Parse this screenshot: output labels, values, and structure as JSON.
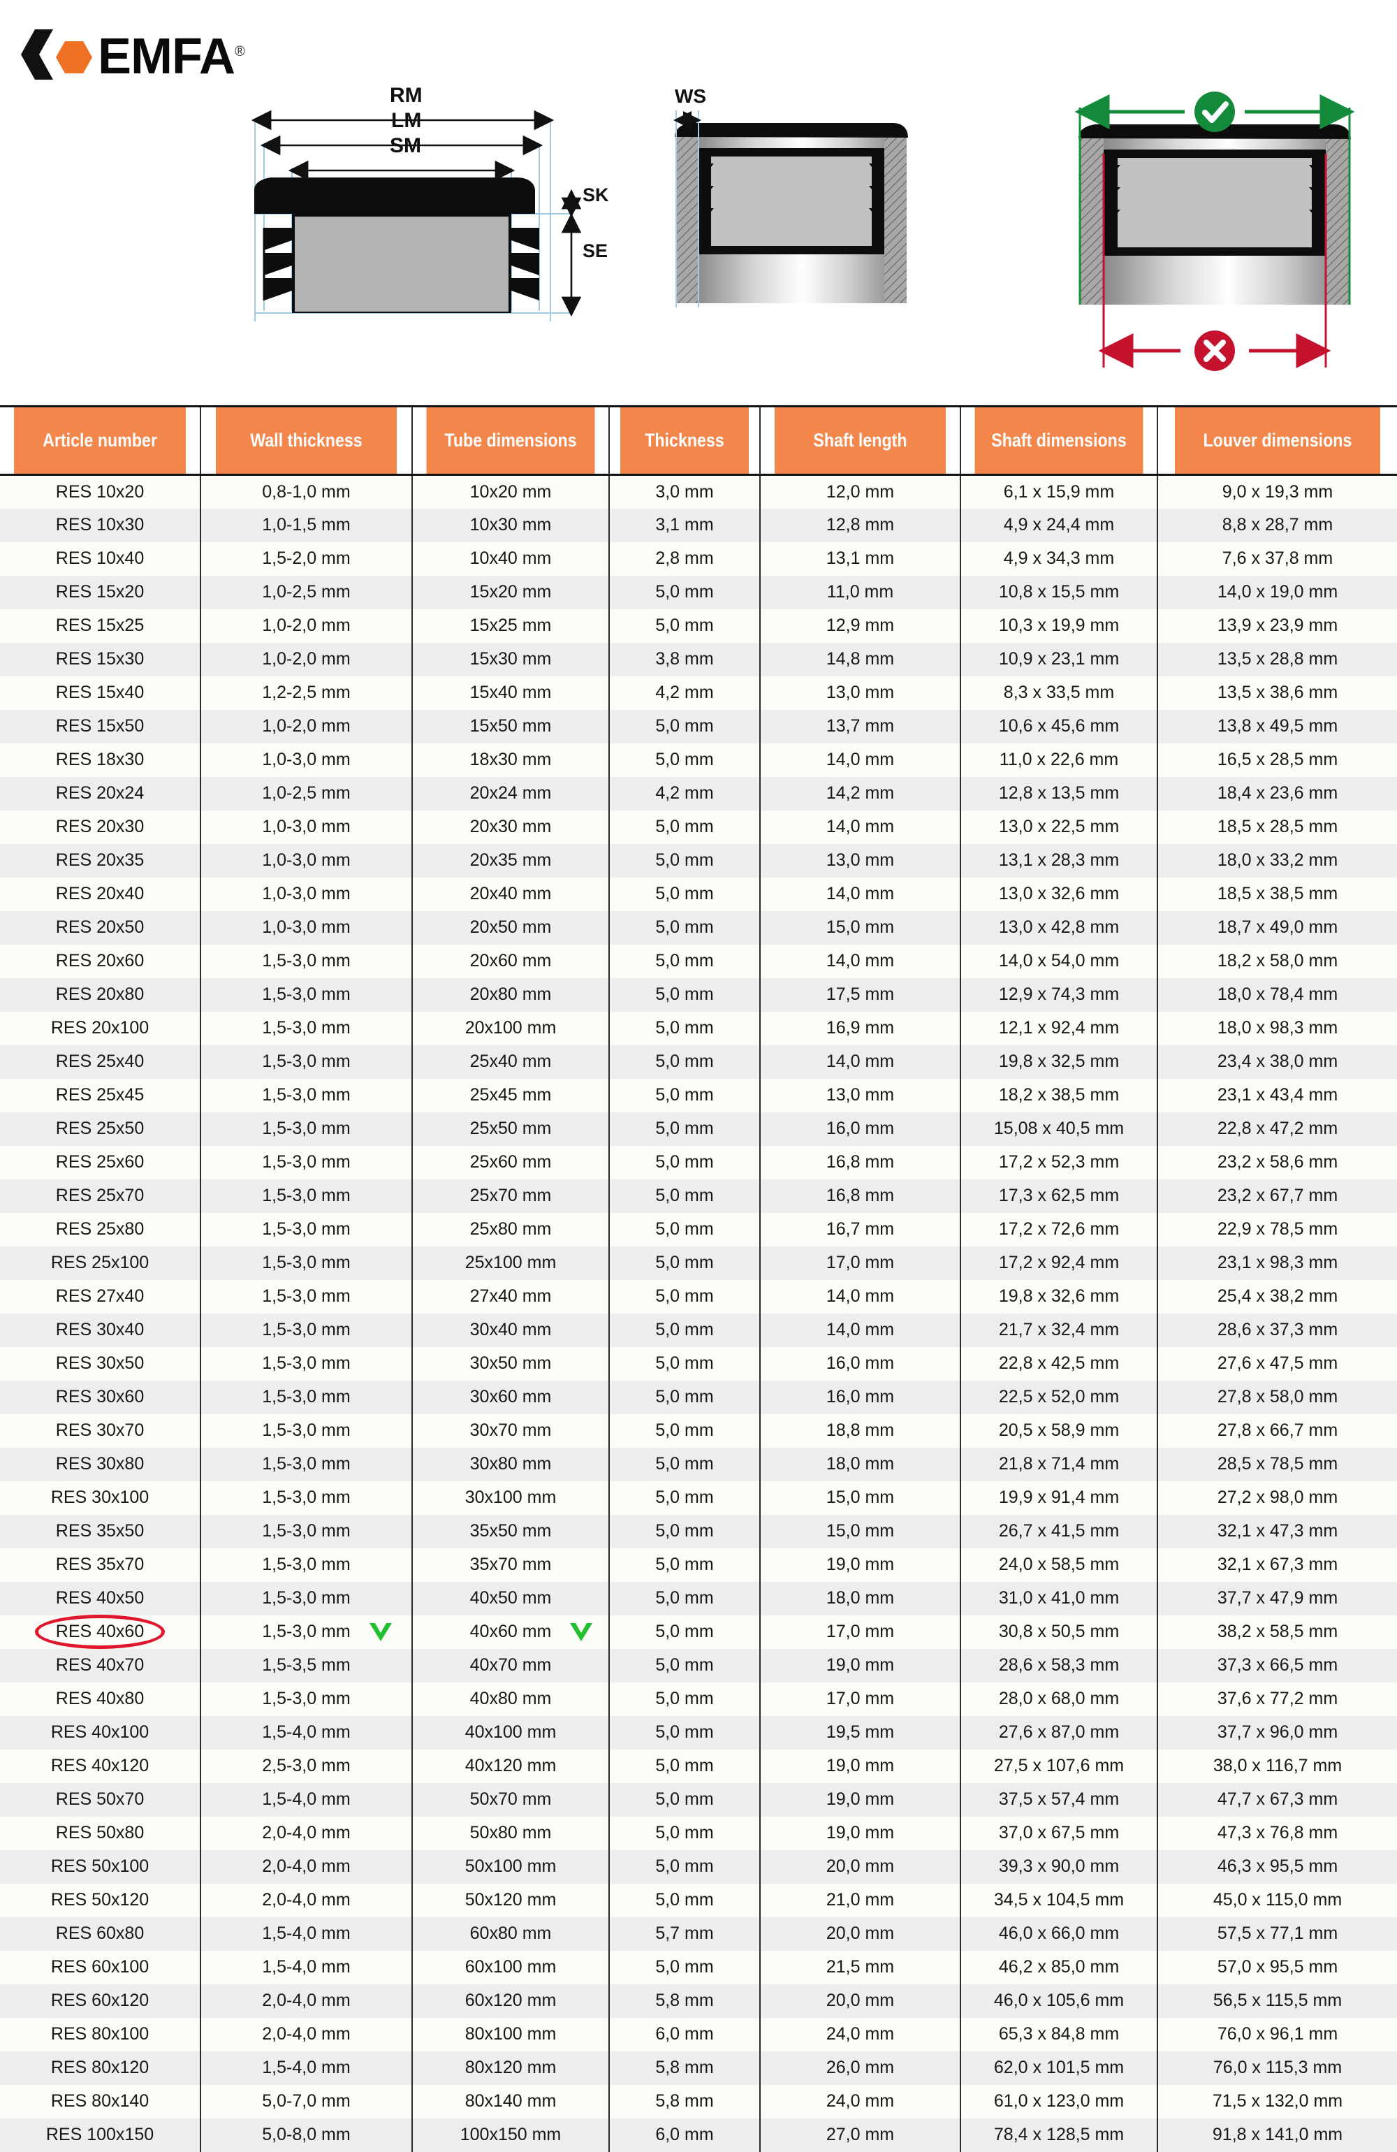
{
  "brand": {
    "name": "EMFA",
    "registered_mark": "®",
    "logo_hex_color": "#EE7023",
    "logo_bracket_color": "#111111"
  },
  "diagrams": {
    "cap_profile": {
      "labels": [
        "RM",
        "LM",
        "SM",
        "SK",
        "SE"
      ],
      "caption_rm": "RM",
      "caption_lm": "LM",
      "caption_sm": "SM",
      "caption_sk": "SK",
      "caption_se": "SE"
    },
    "wall_detail": {
      "caption_ws": "WS"
    },
    "fit_check": {
      "correct_symbol": "check-mark",
      "incorrect_symbol": "cross-mark",
      "correct_color": "#138B3B",
      "incorrect_color": "#C4122F"
    }
  },
  "table": {
    "accent_color": "#F2864B",
    "headers": [
      "Article number",
      "Wall thickness",
      "Tube dimensions",
      "Thickness",
      "Shaft length",
      "Shaft dimensions",
      "Louver dimensions"
    ],
    "highlight": {
      "article": "RES 40x60",
      "ellipse_color": "#E0162B",
      "check_color": "#22C031"
    },
    "rows": [
      [
        "RES 10x20",
        "0,8-1,0 mm",
        "10x20 mm",
        "3,0 mm",
        "12,0 mm",
        "6,1 x 15,9 mm",
        "9,0 x 19,3 mm"
      ],
      [
        "RES 10x30",
        "1,0-1,5 mm",
        "10x30 mm",
        "3,1 mm",
        "12,8 mm",
        "4,9 x 24,4 mm",
        "8,8 x 28,7 mm"
      ],
      [
        "RES 10x40",
        "1,5-2,0 mm",
        "10x40 mm",
        "2,8 mm",
        "13,1 mm",
        "4,9 x 34,3 mm",
        "7,6 x 37,8 mm"
      ],
      [
        "RES 15x20",
        "1,0-2,5 mm",
        "15x20 mm",
        "5,0 mm",
        "11,0 mm",
        "10,8 x 15,5 mm",
        "14,0 x 19,0 mm"
      ],
      [
        "RES 15x25",
        "1,0-2,0 mm",
        "15x25 mm",
        "5,0 mm",
        "12,9 mm",
        "10,3 x 19,9 mm",
        "13,9 x 23,9 mm"
      ],
      [
        "RES 15x30",
        "1,0-2,0 mm",
        "15x30 mm",
        "3,8 mm",
        "14,8 mm",
        "10,9 x 23,1 mm",
        "13,5 x 28,8 mm"
      ],
      [
        "RES 15x40",
        "1,2-2,5 mm",
        "15x40 mm",
        "4,2 mm",
        "13,0 mm",
        "8,3 x 33,5 mm",
        "13,5 x 38,6 mm"
      ],
      [
        "RES 15x50",
        "1,0-2,0 mm",
        "15x50 mm",
        "5,0 mm",
        "13,7 mm",
        "10,6 x 45,6 mm",
        "13,8 x 49,5 mm"
      ],
      [
        "RES 18x30",
        "1,0-3,0 mm",
        "18x30 mm",
        "5,0 mm",
        "14,0 mm",
        "11,0 x 22,6 mm",
        "16,5 x 28,5 mm"
      ],
      [
        "RES 20x24",
        "1,0-2,5 mm",
        "20x24 mm",
        "4,2 mm",
        "14,2 mm",
        "12,8 x 13,5 mm",
        "18,4 x 23,6 mm"
      ],
      [
        "RES 20x30",
        "1,0-3,0 mm",
        "20x30 mm",
        "5,0 mm",
        "14,0 mm",
        "13,0 x 22,5 mm",
        "18,5 x 28,5 mm"
      ],
      [
        "RES 20x35",
        "1,0-3,0 mm",
        "20x35 mm",
        "5,0 mm",
        "13,0 mm",
        "13,1 x 28,3 mm",
        "18,0 x 33,2 mm"
      ],
      [
        "RES 20x40",
        "1,0-3,0 mm",
        "20x40 mm",
        "5,0 mm",
        "14,0 mm",
        "13,0 x 32,6 mm",
        "18,5 x 38,5 mm"
      ],
      [
        "RES 20x50",
        "1,0-3,0 mm",
        "20x50 mm",
        "5,0 mm",
        "15,0 mm",
        "13,0 x 42,8 mm",
        "18,7 x 49,0 mm"
      ],
      [
        "RES 20x60",
        "1,5-3,0 mm",
        "20x60 mm",
        "5,0 mm",
        "14,0 mm",
        "14,0 x 54,0 mm",
        "18,2 x 58,0 mm"
      ],
      [
        "RES 20x80",
        "1,5-3,0 mm",
        "20x80 mm",
        "5,0 mm",
        "17,5 mm",
        "12,9 x 74,3 mm",
        "18,0 x 78,4 mm"
      ],
      [
        "RES 20x100",
        "1,5-3,0 mm",
        "20x100 mm",
        "5,0 mm",
        "16,9 mm",
        "12,1 x 92,4 mm",
        "18,0 x 98,3 mm"
      ],
      [
        "RES 25x40",
        "1,5-3,0 mm",
        "25x40 mm",
        "5,0 mm",
        "14,0 mm",
        "19,8 x 32,5 mm",
        "23,4 x 38,0 mm"
      ],
      [
        "RES 25x45",
        "1,5-3,0 mm",
        "25x45 mm",
        "5,0 mm",
        "13,0 mm",
        "18,2 x 38,5 mm",
        "23,1 x 43,4 mm"
      ],
      [
        "RES 25x50",
        "1,5-3,0 mm",
        "25x50 mm",
        "5,0 mm",
        "16,0 mm",
        "15,08 x 40,5 mm",
        "22,8 x 47,2 mm"
      ],
      [
        "RES 25x60",
        "1,5-3,0 mm",
        "25x60 mm",
        "5,0 mm",
        "16,8 mm",
        "17,2 x 52,3 mm",
        "23,2 x 58,6 mm"
      ],
      [
        "RES 25x70",
        "1,5-3,0 mm",
        "25x70 mm",
        "5,0 mm",
        "16,8 mm",
        "17,3 x 62,5 mm",
        "23,2 x 67,7 mm"
      ],
      [
        "RES 25x80",
        "1,5-3,0 mm",
        "25x80 mm",
        "5,0 mm",
        "16,7 mm",
        "17,2 x 72,6 mm",
        "22,9 x 78,5 mm"
      ],
      [
        "RES 25x100",
        "1,5-3,0 mm",
        "25x100 mm",
        "5,0 mm",
        "17,0 mm",
        "17,2 x 92,4 mm",
        "23,1 x 98,3 mm"
      ],
      [
        "RES 27x40",
        "1,5-3,0 mm",
        "27x40 mm",
        "5,0 mm",
        "14,0 mm",
        "19,8 x 32,6 mm",
        "25,4 x 38,2 mm"
      ],
      [
        "RES 30x40",
        "1,5-3,0 mm",
        "30x40 mm",
        "5,0 mm",
        "14,0 mm",
        "21,7 x 32,4 mm",
        "28,6 x 37,3 mm"
      ],
      [
        "RES 30x50",
        "1,5-3,0 mm",
        "30x50 mm",
        "5,0 mm",
        "16,0 mm",
        "22,8 x 42,5 mm",
        "27,6 x 47,5 mm"
      ],
      [
        "RES 30x60",
        "1,5-3,0 mm",
        "30x60 mm",
        "5,0 mm",
        "16,0 mm",
        "22,5 x 52,0 mm",
        "27,8 x 58,0 mm"
      ],
      [
        "RES 30x70",
        "1,5-3,0 mm",
        "30x70 mm",
        "5,0 mm",
        "18,8 mm",
        "20,5 x 58,9 mm",
        "27,8 x 66,7 mm"
      ],
      [
        "RES 30x80",
        "1,5-3,0 mm",
        "30x80 mm",
        "5,0 mm",
        "18,0 mm",
        "21,8 x 71,4 mm",
        "28,5 x 78,5 mm"
      ],
      [
        "RES 30x100",
        "1,5-3,0 mm",
        "30x100 mm",
        "5,0 mm",
        "15,0 mm",
        "19,9 x 91,4 mm",
        "27,2 x 98,0 mm"
      ],
      [
        "RES 35x50",
        "1,5-3,0 mm",
        "35x50 mm",
        "5,0 mm",
        "15,0 mm",
        "26,7 x 41,5 mm",
        "32,1 x 47,3 mm"
      ],
      [
        "RES 35x70",
        "1,5-3,0 mm",
        "35x70 mm",
        "5,0 mm",
        "19,0 mm",
        "24,0 x 58,5 mm",
        "32,1 x 67,3 mm"
      ],
      [
        "RES 40x50",
        "1,5-3,0 mm",
        "40x50 mm",
        "5,0 mm",
        "18,0 mm",
        "31,0 x 41,0 mm",
        "37,7 x 47,9 mm"
      ],
      [
        "RES 40x60",
        "1,5-3,0 mm",
        "40x60 mm",
        "5,0 mm",
        "17,0 mm",
        "30,8 x 50,5 mm",
        "38,2 x 58,5 mm"
      ],
      [
        "RES 40x70",
        "1,5-3,5 mm",
        "40x70 mm",
        "5,0 mm",
        "19,0 mm",
        "28,6 x 58,3 mm",
        "37,3 x 66,5 mm"
      ],
      [
        "RES 40x80",
        "1,5-3,0 mm",
        "40x80 mm",
        "5,0 mm",
        "17,0 mm",
        "28,0 x 68,0 mm",
        "37,6 x 77,2 mm"
      ],
      [
        "RES 40x100",
        "1,5-4,0 mm",
        "40x100 mm",
        "5,0 mm",
        "19,5 mm",
        "27,6 x 87,0 mm",
        "37,7 x 96,0 mm"
      ],
      [
        "RES 40x120",
        "2,5-3,0 mm",
        "40x120 mm",
        "5,0 mm",
        "19,0 mm",
        "27,5 x 107,6 mm",
        "38,0 x 116,7 mm"
      ],
      [
        "RES 50x70",
        "1,5-4,0 mm",
        "50x70 mm",
        "5,0 mm",
        "19,0 mm",
        "37,5 x 57,4 mm",
        "47,7 x 67,3 mm"
      ],
      [
        "RES 50x80",
        "2,0-4,0 mm",
        "50x80 mm",
        "5,0 mm",
        "19,0 mm",
        "37,0 x 67,5 mm",
        "47,3 x 76,8 mm"
      ],
      [
        "RES 50x100",
        "2,0-4,0 mm",
        "50x100 mm",
        "5,0 mm",
        "20,0 mm",
        "39,3 x 90,0 mm",
        "46,3 x 95,5 mm"
      ],
      [
        "RES 50x120",
        "2,0-4,0 mm",
        "50x120 mm",
        "5,0 mm",
        "21,0 mm",
        "34,5 x 104,5 mm",
        "45,0 x 115,0 mm"
      ],
      [
        "RES 60x80",
        "1,5-4,0 mm",
        "60x80 mm",
        "5,7 mm",
        "20,0 mm",
        "46,0 x 66,0 mm",
        "57,5 x 77,1 mm"
      ],
      [
        "RES 60x100",
        "1,5-4,0 mm",
        "60x100 mm",
        "5,0 mm",
        "21,5 mm",
        "46,2 x 85,0 mm",
        "57,0 x 95,5 mm"
      ],
      [
        "RES 60x120",
        "2,0-4,0 mm",
        "60x120 mm",
        "5,8 mm",
        "20,0 mm",
        "46,0 x 105,6 mm",
        "56,5 x 115,5 mm"
      ],
      [
        "RES 80x100",
        "2,0-4,0 mm",
        "80x100 mm",
        "6,0 mm",
        "24,0 mm",
        "65,3 x 84,8 mm",
        "76,0 x 96,1 mm"
      ],
      [
        "RES 80x120",
        "1,5-4,0 mm",
        "80x120 mm",
        "5,8 mm",
        "26,0 mm",
        "62,0 x 101,5 mm",
        "76,0 x 115,3 mm"
      ],
      [
        "RES 80x140",
        "5,0-7,0 mm",
        "80x140 mm",
        "5,8 mm",
        "24,0 mm",
        "61,0 x 123,0 mm",
        "71,5 x 132,0 mm"
      ],
      [
        "RES 100x150",
        "5,0-8,0 mm",
        "100x150 mm",
        "6,0 mm",
        "27,0 mm",
        "78,4 x 128,5 mm",
        "91,8 x 141,0 mm"
      ]
    ]
  }
}
